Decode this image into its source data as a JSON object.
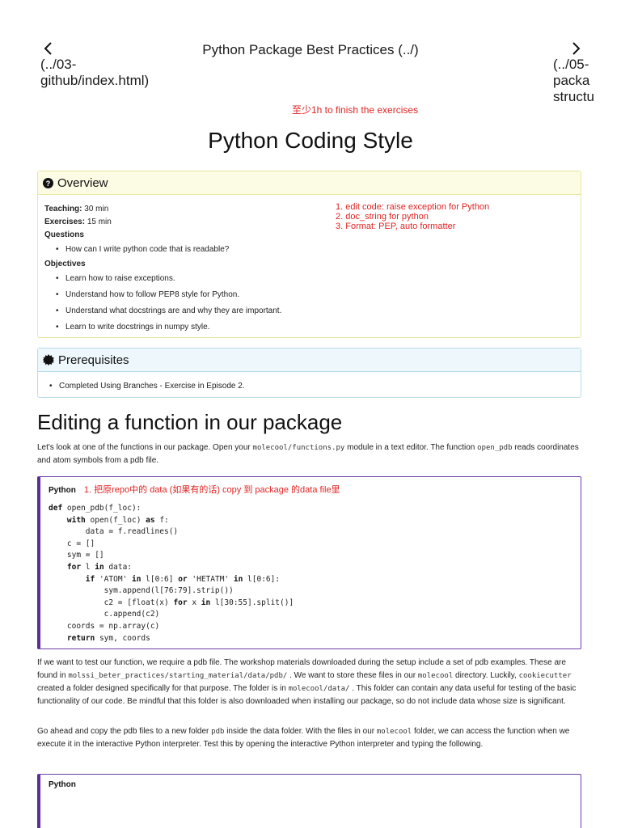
{
  "nav": {
    "prev_link": "(../03-\ngithub/index.html)",
    "next_link": "(../05-\npacka\nstructu",
    "title": "Python Package Best Practices (../)"
  },
  "top_note": "至少1h to finish the exercises",
  "page_title": "Python Coding Style",
  "overview": {
    "heading": "Overview",
    "teaching_label": "Teaching:",
    "teaching_value": "30 min",
    "exercises_label": "Exercises:",
    "exercises_value": "15 min",
    "questions_label": "Questions",
    "questions": [
      "How can I write python code that is readable?"
    ],
    "objectives_label": "Objectives",
    "objectives": [
      "Learn how to raise exceptions.",
      "Understand how to follow PEP8 style for Python.",
      "Understand what docstrings are and why they are important.",
      "Learn to write docstrings in numpy style."
    ],
    "notes": [
      "1. edit code: raise exception for Python",
      "2. doc_string for python",
      "3. Format: PEP, auto formatter"
    ]
  },
  "prereq": {
    "heading": "Prerequisites",
    "items": [
      "Completed Using Branches - Exercise in Episode 2."
    ]
  },
  "section": {
    "heading": "Editing a function in our package",
    "intro_1": "Let's look at one of the functions in our package. Open your",
    "intro_code_1": "molecool/functions.py",
    "intro_2": "module in a text editor. The function",
    "intro_code_2": "open_pdb",
    "intro_3": "reads coordinates and atom symbols from a pdb file."
  },
  "code_block_1": {
    "lang": "Python",
    "note": "1. 把原repo中的 data (如果有的话)   copy 到 package 的data file里"
  },
  "para_2": {
    "t1": "If we want to test our function, we require a pdb file. The workshop materials downloaded during the setup include a set of pdb examples. These are found in",
    "c1": "molssi_beter_practices/starting_material/data/pdb/",
    "t2": ". We want to store these files in our",
    "c2": "molecool",
    "t3": "directory. Luckily,",
    "c3": "cookiecutter",
    "t4": "created a folder designed specifically for that purpose. The folder is in",
    "c4": "molecool/data/",
    "t5": ". This folder can contain any data useful for testing of the basic functionality of our code. Be mindful that this folder is also downloaded when installing our package, so do not include data whose size is significant."
  },
  "para_3": {
    "t1": "Go ahead and copy the pdb files to a new folder",
    "c1": "pdb",
    "t2": "inside the data folder. With the files in our",
    "c2": "molecool",
    "t3": "folder, we can access the function when we execute it in the interactive Python interpreter. Test this by opening the interactive Python interpreter and typing the following."
  },
  "code_block_2": {
    "lang": "Python"
  }
}
